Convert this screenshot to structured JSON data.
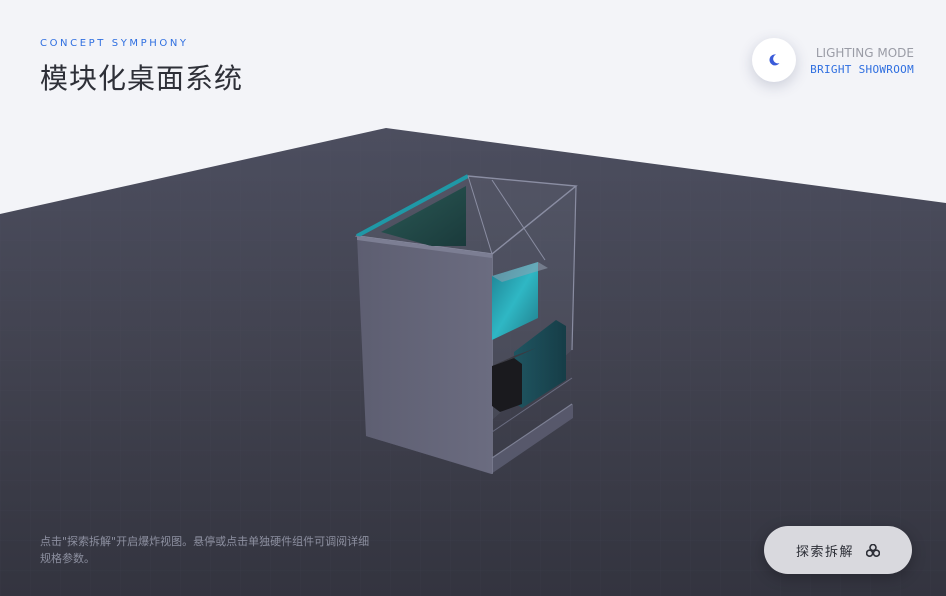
{
  "header": {
    "eyebrow": "CONCEPT SYMPHONY",
    "title": "模块化桌面系统"
  },
  "lighting": {
    "icon": "moon-icon",
    "label": "LIGHTING MODE",
    "value": "BRIGHT SHOWROOM"
  },
  "hint": {
    "text": "点击\"探索拆解\"开启爆炸视图。悬停或点击单独硬件组件可调阅详细规格参数。"
  },
  "explode_button": {
    "label": "探索拆解",
    "icon": "explode-icon"
  },
  "colors": {
    "accent": "#2f6fe0",
    "floor": "#454859",
    "background": "#f3f4f8",
    "teal": "#2fb7c4"
  }
}
